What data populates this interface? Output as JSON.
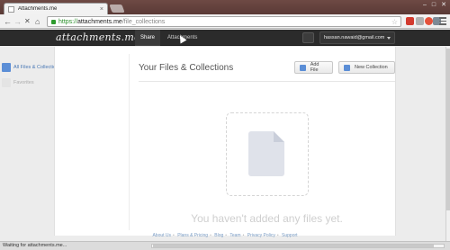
{
  "browser": {
    "tab_title": "Attachments.me",
    "tab_close": "×",
    "url_scheme": "https://",
    "url_host": "attachments.me",
    "url_path": "/file_collections",
    "back": "←",
    "forward": "→",
    "stop": "✕",
    "home": "⌂",
    "star": "☆",
    "status_text": "Waiting for attachments.me...",
    "extension_colors": [
      "#d23a2e",
      "#b0b0b0",
      "#e5513a",
      "#7d8a96"
    ]
  },
  "app": {
    "logo": "attachments.me",
    "nav": {
      "share": "Share",
      "attachments": "Attachments"
    },
    "user_email": "hassan.nawaid@gmail.com"
  },
  "sidebar": {
    "items": [
      {
        "label": "All Files & Collections",
        "active": true
      },
      {
        "label": "Favorites",
        "active": false
      }
    ]
  },
  "main": {
    "title": "Your Files & Collections",
    "add_file": "Add File",
    "new_collection": "New Collection",
    "empty_message": "You haven't added any files yet."
  },
  "footer": {
    "links": [
      "About Us",
      "Plans & Pricing",
      "Blog",
      "Team",
      "Privacy Policy",
      "Support"
    ]
  },
  "colors": {
    "accent": "#5b8ed6",
    "header_bg": "#2b2b2b",
    "link": "#7a9cc4"
  }
}
